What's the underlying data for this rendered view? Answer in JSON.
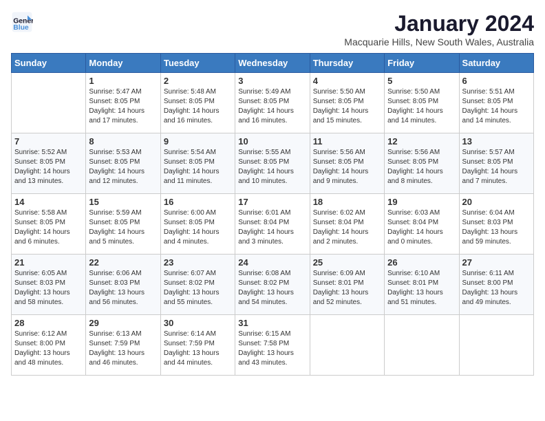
{
  "app": {
    "logo_line1": "General",
    "logo_line2": "Blue",
    "month_title": "January 2024",
    "subtitle": "Macquarie Hills, New South Wales, Australia"
  },
  "days_of_week": [
    "Sunday",
    "Monday",
    "Tuesday",
    "Wednesday",
    "Thursday",
    "Friday",
    "Saturday"
  ],
  "weeks": [
    [
      {
        "day": "",
        "info": ""
      },
      {
        "day": "1",
        "info": "Sunrise: 5:47 AM\nSunset: 8:05 PM\nDaylight: 14 hours\nand 17 minutes."
      },
      {
        "day": "2",
        "info": "Sunrise: 5:48 AM\nSunset: 8:05 PM\nDaylight: 14 hours\nand 16 minutes."
      },
      {
        "day": "3",
        "info": "Sunrise: 5:49 AM\nSunset: 8:05 PM\nDaylight: 14 hours\nand 16 minutes."
      },
      {
        "day": "4",
        "info": "Sunrise: 5:50 AM\nSunset: 8:05 PM\nDaylight: 14 hours\nand 15 minutes."
      },
      {
        "day": "5",
        "info": "Sunrise: 5:50 AM\nSunset: 8:05 PM\nDaylight: 14 hours\nand 14 minutes."
      },
      {
        "day": "6",
        "info": "Sunrise: 5:51 AM\nSunset: 8:05 PM\nDaylight: 14 hours\nand 14 minutes."
      }
    ],
    [
      {
        "day": "7",
        "info": "Sunrise: 5:52 AM\nSunset: 8:05 PM\nDaylight: 14 hours\nand 13 minutes."
      },
      {
        "day": "8",
        "info": "Sunrise: 5:53 AM\nSunset: 8:05 PM\nDaylight: 14 hours\nand 12 minutes."
      },
      {
        "day": "9",
        "info": "Sunrise: 5:54 AM\nSunset: 8:05 PM\nDaylight: 14 hours\nand 11 minutes."
      },
      {
        "day": "10",
        "info": "Sunrise: 5:55 AM\nSunset: 8:05 PM\nDaylight: 14 hours\nand 10 minutes."
      },
      {
        "day": "11",
        "info": "Sunrise: 5:56 AM\nSunset: 8:05 PM\nDaylight: 14 hours\nand 9 minutes."
      },
      {
        "day": "12",
        "info": "Sunrise: 5:56 AM\nSunset: 8:05 PM\nDaylight: 14 hours\nand 8 minutes."
      },
      {
        "day": "13",
        "info": "Sunrise: 5:57 AM\nSunset: 8:05 PM\nDaylight: 14 hours\nand 7 minutes."
      }
    ],
    [
      {
        "day": "14",
        "info": "Sunrise: 5:58 AM\nSunset: 8:05 PM\nDaylight: 14 hours\nand 6 minutes."
      },
      {
        "day": "15",
        "info": "Sunrise: 5:59 AM\nSunset: 8:05 PM\nDaylight: 14 hours\nand 5 minutes."
      },
      {
        "day": "16",
        "info": "Sunrise: 6:00 AM\nSunset: 8:05 PM\nDaylight: 14 hours\nand 4 minutes."
      },
      {
        "day": "17",
        "info": "Sunrise: 6:01 AM\nSunset: 8:04 PM\nDaylight: 14 hours\nand 3 minutes."
      },
      {
        "day": "18",
        "info": "Sunrise: 6:02 AM\nSunset: 8:04 PM\nDaylight: 14 hours\nand 2 minutes."
      },
      {
        "day": "19",
        "info": "Sunrise: 6:03 AM\nSunset: 8:04 PM\nDaylight: 14 hours\nand 0 minutes."
      },
      {
        "day": "20",
        "info": "Sunrise: 6:04 AM\nSunset: 8:03 PM\nDaylight: 13 hours\nand 59 minutes."
      }
    ],
    [
      {
        "day": "21",
        "info": "Sunrise: 6:05 AM\nSunset: 8:03 PM\nDaylight: 13 hours\nand 58 minutes."
      },
      {
        "day": "22",
        "info": "Sunrise: 6:06 AM\nSunset: 8:03 PM\nDaylight: 13 hours\nand 56 minutes."
      },
      {
        "day": "23",
        "info": "Sunrise: 6:07 AM\nSunset: 8:02 PM\nDaylight: 13 hours\nand 55 minutes."
      },
      {
        "day": "24",
        "info": "Sunrise: 6:08 AM\nSunset: 8:02 PM\nDaylight: 13 hours\nand 54 minutes."
      },
      {
        "day": "25",
        "info": "Sunrise: 6:09 AM\nSunset: 8:01 PM\nDaylight: 13 hours\nand 52 minutes."
      },
      {
        "day": "26",
        "info": "Sunrise: 6:10 AM\nSunset: 8:01 PM\nDaylight: 13 hours\nand 51 minutes."
      },
      {
        "day": "27",
        "info": "Sunrise: 6:11 AM\nSunset: 8:00 PM\nDaylight: 13 hours\nand 49 minutes."
      }
    ],
    [
      {
        "day": "28",
        "info": "Sunrise: 6:12 AM\nSunset: 8:00 PM\nDaylight: 13 hours\nand 48 minutes."
      },
      {
        "day": "29",
        "info": "Sunrise: 6:13 AM\nSunset: 7:59 PM\nDaylight: 13 hours\nand 46 minutes."
      },
      {
        "day": "30",
        "info": "Sunrise: 6:14 AM\nSunset: 7:59 PM\nDaylight: 13 hours\nand 44 minutes."
      },
      {
        "day": "31",
        "info": "Sunrise: 6:15 AM\nSunset: 7:58 PM\nDaylight: 13 hours\nand 43 minutes."
      },
      {
        "day": "",
        "info": ""
      },
      {
        "day": "",
        "info": ""
      },
      {
        "day": "",
        "info": ""
      }
    ]
  ]
}
